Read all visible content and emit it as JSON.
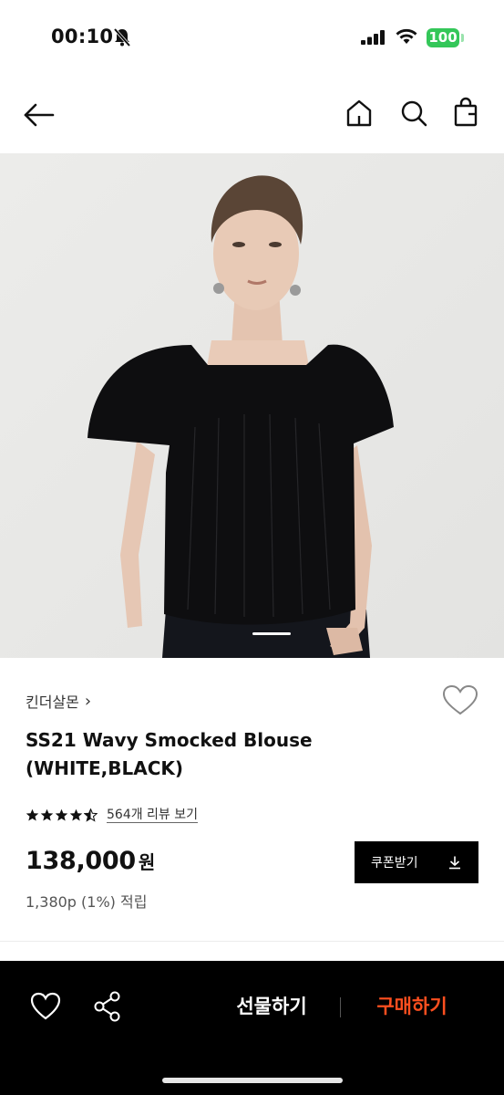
{
  "status_bar": {
    "time": "00:10",
    "battery": "100",
    "battery_color": "#34c759"
  },
  "header": {
    "icons": [
      "back-arrow-icon",
      "home-icon",
      "search-icon",
      "shopping-bag-icon"
    ]
  },
  "product": {
    "image_indicator": {
      "current": 1
    },
    "brand": "킨더살몬",
    "brand_chevron": "›",
    "title_line1": "SS21 Wavy Smocked Blouse",
    "title_line2": "(WHITE,BLACK)",
    "rating": 4.5,
    "rating_max": 5,
    "review_link": "564개 리뷰 보기",
    "price": "138,000",
    "currency": "원",
    "points": "1,380p (1%) 적립",
    "coupon_button": "쿠폰받기"
  },
  "bottom_bar": {
    "gift_label": "선물하기",
    "buy_label": "구매하기",
    "buy_color": "#ff4f1f",
    "icons": [
      "heart-icon",
      "share-icon"
    ]
  }
}
